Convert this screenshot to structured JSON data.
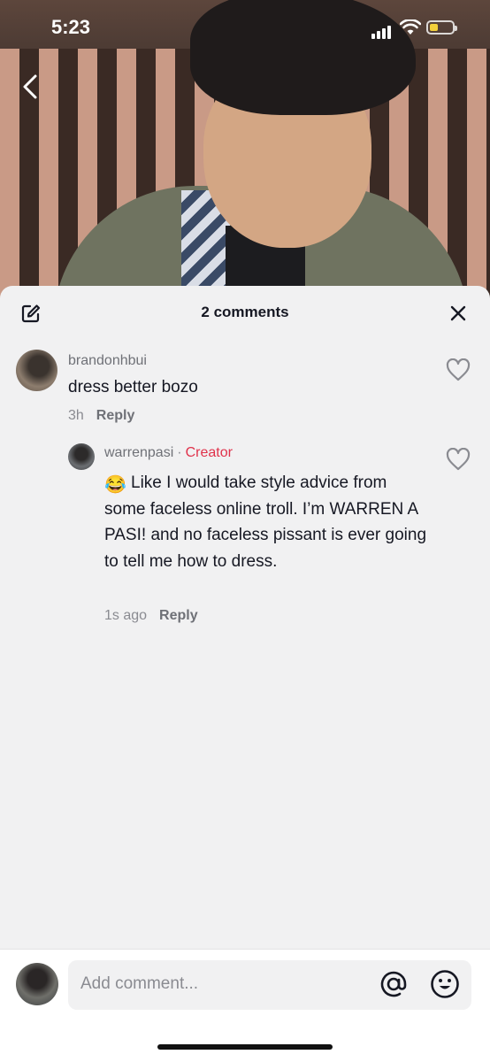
{
  "status_bar": {
    "time": "5:23"
  },
  "sheet": {
    "title": "2 comments"
  },
  "comments": [
    {
      "username": "brandonhbui",
      "text": "dress better bozo",
      "time": "3h",
      "reply_label": "Reply"
    }
  ],
  "replies": [
    {
      "username": "warrenpasi",
      "separator": "·",
      "badge": "Creator",
      "emoji": "😂",
      "text": "Like I would take style advice from some faceless online troll. I’m WARREN A PASI! and no faceless pissant is ever going to tell me how to dress.",
      "time": "1s ago",
      "reply_label": "Reply"
    }
  ],
  "composer": {
    "placeholder": "Add comment..."
  },
  "colors": {
    "creator": "#e0324b",
    "battery": "#f3d03b",
    "sheet_bg": "#f1f1f2"
  },
  "icons": [
    "back-icon",
    "edit-icon",
    "close-icon",
    "heart-icon",
    "at-icon",
    "emoji-icon",
    "signal-icon",
    "wifi-icon",
    "battery-icon"
  ]
}
